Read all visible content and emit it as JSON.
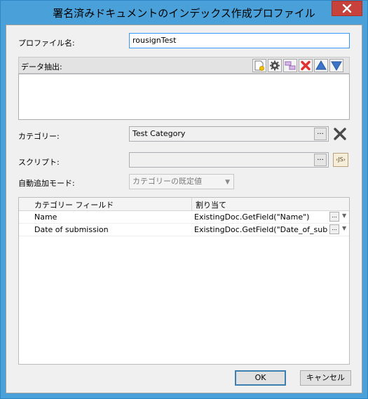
{
  "window": {
    "title": "署名済みドキュメントのインデックス作成プロファイル",
    "close_glyph": "✕"
  },
  "profile": {
    "label": "プロファイル名:",
    "value": "rousignTest"
  },
  "extraction": {
    "label": "データ抽出:",
    "tools": [
      "new-document-icon",
      "gear-icon",
      "mapping-icon",
      "delete-icon",
      "move-up-icon",
      "move-down-icon"
    ]
  },
  "category": {
    "label": "カテゴリー:",
    "value": "Test Category",
    "browse": "..."
  },
  "script": {
    "label": "スクリプト:",
    "value": "",
    "browse": "...",
    "js_badge": "‹JS›"
  },
  "automode": {
    "label": "自動追加モード:",
    "value": "カテゴリーの既定値"
  },
  "grid": {
    "headers": [
      "カテゴリー フィールド",
      "割り当て"
    ],
    "rows": [
      {
        "field": "Name",
        "assign": "ExistingDoc.GetField(\"Name\")"
      },
      {
        "field": "Date of submission",
        "assign": "ExistingDoc.GetField(\"Date_of_submission\")"
      }
    ],
    "cell_button": "...",
    "cell_arrow": "▼"
  },
  "buttons": {
    "ok": "OK",
    "cancel": "キャンセル"
  },
  "colors": {
    "titlebar": "#4aa0d8",
    "close": "#c7423a",
    "delete": "#e03030",
    "arrow": "#3b74c8"
  }
}
